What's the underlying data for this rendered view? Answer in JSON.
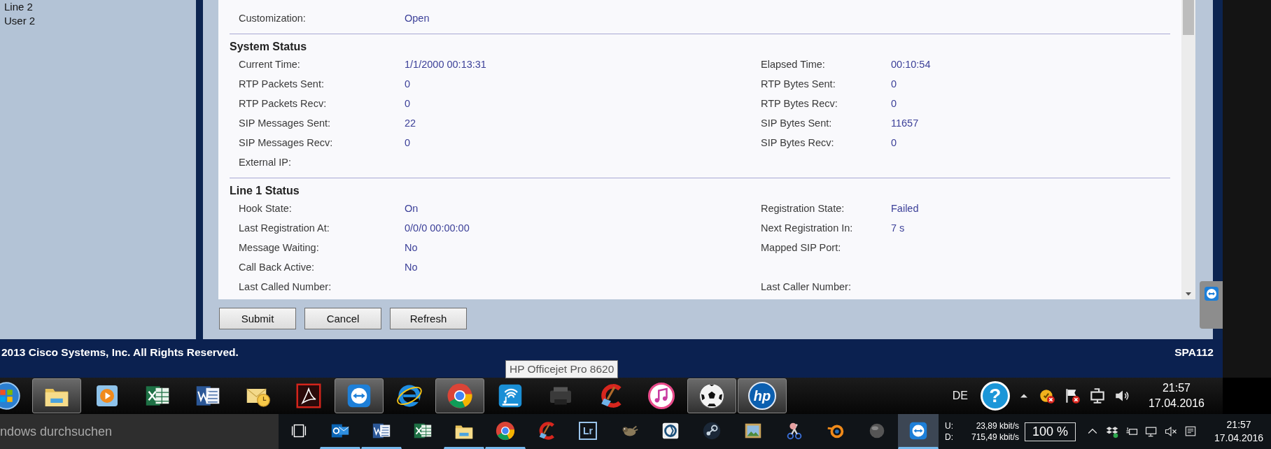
{
  "sidebar": {
    "items": [
      "Line 2",
      "User 2"
    ]
  },
  "status_sections": [
    {
      "rows": [
        {
          "left": {
            "label": "Customization:",
            "value": "Open"
          }
        }
      ]
    },
    {
      "title": "System Status",
      "rows": [
        {
          "left": {
            "label": "Current Time:",
            "value": "1/1/2000 00:13:31"
          },
          "right": {
            "label": "Elapsed Time:",
            "value": "00:10:54"
          }
        },
        {
          "left": {
            "label": "RTP Packets Sent:",
            "value": "0"
          },
          "right": {
            "label": "RTP Bytes Sent:",
            "value": "0"
          }
        },
        {
          "left": {
            "label": "RTP Packets Recv:",
            "value": "0"
          },
          "right": {
            "label": "RTP Bytes Recv:",
            "value": "0"
          }
        },
        {
          "left": {
            "label": "SIP Messages Sent:",
            "value": "22"
          },
          "right": {
            "label": "SIP Bytes Sent:",
            "value": "11657"
          }
        },
        {
          "left": {
            "label": "SIP Messages Recv:",
            "value": "0"
          },
          "right": {
            "label": "SIP Bytes Recv:",
            "value": "0"
          }
        },
        {
          "left": {
            "label": "External IP:"
          }
        }
      ]
    },
    {
      "title": "Line 1 Status",
      "rows": [
        {
          "left": {
            "label": "Hook State:",
            "value": "On"
          },
          "right": {
            "label": "Registration State:",
            "value": "Failed"
          }
        },
        {
          "left": {
            "label": "Last Registration At:",
            "value": "0/0/0 00:00:00"
          },
          "right": {
            "label": "Next Registration In:",
            "value": "7 s"
          }
        },
        {
          "left": {
            "label": "Message Waiting:",
            "value": "No"
          },
          "right": {
            "label": "Mapped SIP Port:"
          }
        },
        {
          "left": {
            "label": "Call Back Active:",
            "value": "No"
          }
        },
        {
          "left": {
            "label": "Last Called Number:"
          },
          "right": {
            "label": "Last Caller Number:"
          }
        }
      ]
    }
  ],
  "buttons": [
    "Submit",
    "Cancel",
    "Refresh"
  ],
  "footer": {
    "copyright": "2013 Cisco Systems, Inc. All Rights Reserved.",
    "model": "SPA112"
  },
  "tooltip": "HP Officejet Pro 8620",
  "taskbar_top": {
    "buttons": [
      {
        "kind": "orb",
        "selected": false
      },
      {
        "kind": "folder",
        "selected": true
      },
      {
        "kind": "media",
        "selected": false
      },
      {
        "kind": "spreadsheet",
        "selected": false
      },
      {
        "kind": "document",
        "selected": false
      },
      {
        "kind": "mail",
        "selected": false
      },
      {
        "kind": "pdf",
        "selected": false
      },
      {
        "kind": "remote",
        "selected": true
      },
      {
        "kind": "ie",
        "selected": false
      },
      {
        "kind": "chrome",
        "selected": true
      },
      {
        "kind": "speaker",
        "selected": false
      },
      {
        "kind": "printer",
        "selected": false
      },
      {
        "kind": "broom",
        "selected": false
      },
      {
        "kind": "music",
        "selected": false
      },
      {
        "kind": "ball",
        "selected": true
      },
      {
        "kind": "logo",
        "label": "hp",
        "selected": true
      }
    ],
    "language": "DE",
    "help": "?",
    "time": "21:57",
    "date": "17.04.2016"
  },
  "taskbar_bottom": {
    "search": {
      "placeholder": "ndows durchsuchen"
    },
    "buttons": [
      {
        "kind": "taskview",
        "selected": false,
        "running": false
      },
      {
        "kind": "mail2",
        "selected": false,
        "running": true
      },
      {
        "kind": "document",
        "selected": false,
        "running": true
      },
      {
        "kind": "spreadsheet",
        "selected": false,
        "running": false
      },
      {
        "kind": "folder",
        "selected": false,
        "running": true
      },
      {
        "kind": "chrome",
        "selected": false,
        "running": true
      },
      {
        "kind": "broom",
        "selected": false,
        "running": false
      },
      {
        "kind": "square",
        "label": "Lr",
        "selected": false,
        "running": false
      },
      {
        "kind": "animal",
        "selected": false,
        "running": false
      },
      {
        "kind": "aperture",
        "selected": false,
        "running": false
      },
      {
        "kind": "steam",
        "selected": false,
        "running": false
      },
      {
        "kind": "picture",
        "selected": false,
        "running": false
      },
      {
        "kind": "scissors",
        "selected": false,
        "running": false
      },
      {
        "kind": "ring",
        "selected": false,
        "running": false
      },
      {
        "kind": "sphere",
        "selected": false,
        "running": false
      },
      {
        "kind": "remote",
        "selected": true,
        "running": true
      }
    ],
    "network": {
      "upload_label": "U:",
      "upload": "23,89 kbit/s",
      "download_label": "D:",
      "download": "715,49 kbit/s"
    },
    "battery": "100 %",
    "time": "21:57",
    "date": "17.04.2016"
  }
}
